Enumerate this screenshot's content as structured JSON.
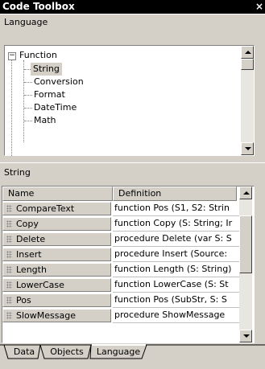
{
  "window": {
    "title": "Code Toolbox",
    "close_glyph": "×"
  },
  "language_header": "Language",
  "tree": {
    "root": {
      "label": "Function",
      "expander": "−"
    },
    "children": [
      "String",
      "Conversion",
      "Format",
      "DateTime",
      "Math"
    ],
    "selected": "String"
  },
  "string_header": "String",
  "grid": {
    "columns": {
      "name": "Name",
      "definition": "Definition"
    },
    "rows": [
      {
        "name": "CompareText",
        "definition": "function Pos (S1, S2: Strin"
      },
      {
        "name": "Copy",
        "definition": "function Copy (S: String; Ir"
      },
      {
        "name": "Delete",
        "definition": "procedure Delete (var S: S"
      },
      {
        "name": "Insert",
        "definition": "procedure Insert (Source:"
      },
      {
        "name": "Length",
        "definition": "function Length (S: String)"
      },
      {
        "name": "LowerCase",
        "definition": "function LowerCase (S: St"
      },
      {
        "name": "Pos",
        "definition": "function Pos (SubStr, S: S"
      },
      {
        "name": "SlowMessage",
        "definition": "procedure ShowMessage"
      }
    ]
  },
  "tabs": [
    {
      "label": "Data",
      "active": false
    },
    {
      "label": "Objects",
      "active": false
    },
    {
      "label": "Language",
      "active": true
    }
  ],
  "colors": {
    "face": "#d4d0c8",
    "title_bg": "#000000",
    "title_fg": "#ffffff"
  }
}
